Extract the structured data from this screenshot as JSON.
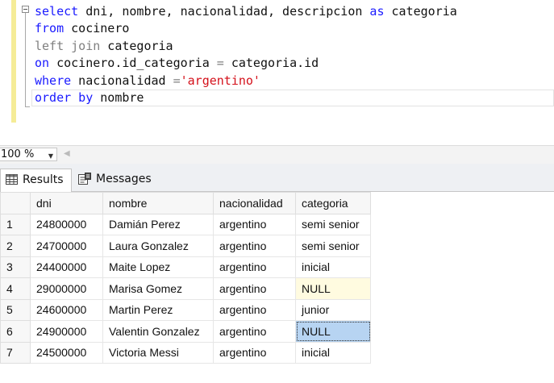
{
  "editor": {
    "lines": [
      [
        {
          "t": "select",
          "c": "kw"
        },
        {
          "t": " dni, nombre, nacionalidad, descripcion ",
          "c": ""
        },
        {
          "t": "as",
          "c": "kw"
        },
        {
          "t": " categoria",
          "c": ""
        }
      ],
      [
        {
          "t": "from",
          "c": "kw"
        },
        {
          "t": " cocinero",
          "c": ""
        }
      ],
      [
        {
          "t": "left join",
          "c": "gr"
        },
        {
          "t": " categoria",
          "c": ""
        }
      ],
      [
        {
          "t": "on",
          "c": "kw"
        },
        {
          "t": " cocinero.id_categoria ",
          "c": ""
        },
        {
          "t": "=",
          "c": "gr"
        },
        {
          "t": " categoria.id",
          "c": ""
        }
      ],
      [
        {
          "t": "where",
          "c": "kw"
        },
        {
          "t": " nacionalidad ",
          "c": ""
        },
        {
          "t": "=",
          "c": "gr"
        },
        {
          "t": "'argentino'",
          "c": "rd"
        }
      ],
      [
        {
          "t": "order by",
          "c": "kw"
        },
        {
          "t": " nombre",
          "c": ""
        }
      ]
    ]
  },
  "zoom": {
    "value": "100 %"
  },
  "tabs": {
    "results": "Results",
    "messages": "Messages"
  },
  "grid": {
    "columns": [
      "",
      "dni",
      "nombre",
      "nacionalidad",
      "categoria"
    ],
    "rows": [
      {
        "num": "1",
        "dni": "24800000",
        "nombre": "Damián Perez",
        "nacionalidad": "argentino",
        "categoria": "semi senior",
        "is_null": false
      },
      {
        "num": "2",
        "dni": "24700000",
        "nombre": "Laura Gonzalez",
        "nacionalidad": "argentino",
        "categoria": "semi senior",
        "is_null": false
      },
      {
        "num": "3",
        "dni": "24400000",
        "nombre": "Maite Lopez",
        "nacionalidad": "argentino",
        "categoria": "inicial",
        "is_null": false
      },
      {
        "num": "4",
        "dni": "29000000",
        "nombre": "Marisa Gomez",
        "nacionalidad": "argentino",
        "categoria": "NULL",
        "is_null": true
      },
      {
        "num": "5",
        "dni": "24600000",
        "nombre": "Martin Perez",
        "nacionalidad": "argentino",
        "categoria": "junior",
        "is_null": false
      },
      {
        "num": "6",
        "dni": "24900000",
        "nombre": "Valentin Gonzalez",
        "nacionalidad": "argentino",
        "categoria": "NULL",
        "is_null": true,
        "selected": true
      },
      {
        "num": "7",
        "dni": "24500000",
        "nombre": "Victoria Messi",
        "nacionalidad": "argentino",
        "categoria": "inicial",
        "is_null": false
      }
    ]
  },
  "colors": {
    "keyword": "#1a1aff",
    "string": "#d4101a",
    "operator": "#808080",
    "null_cell": "#fffbe0",
    "selected_cell": "#b7d4f2",
    "change_bar": "#f5ec97"
  }
}
